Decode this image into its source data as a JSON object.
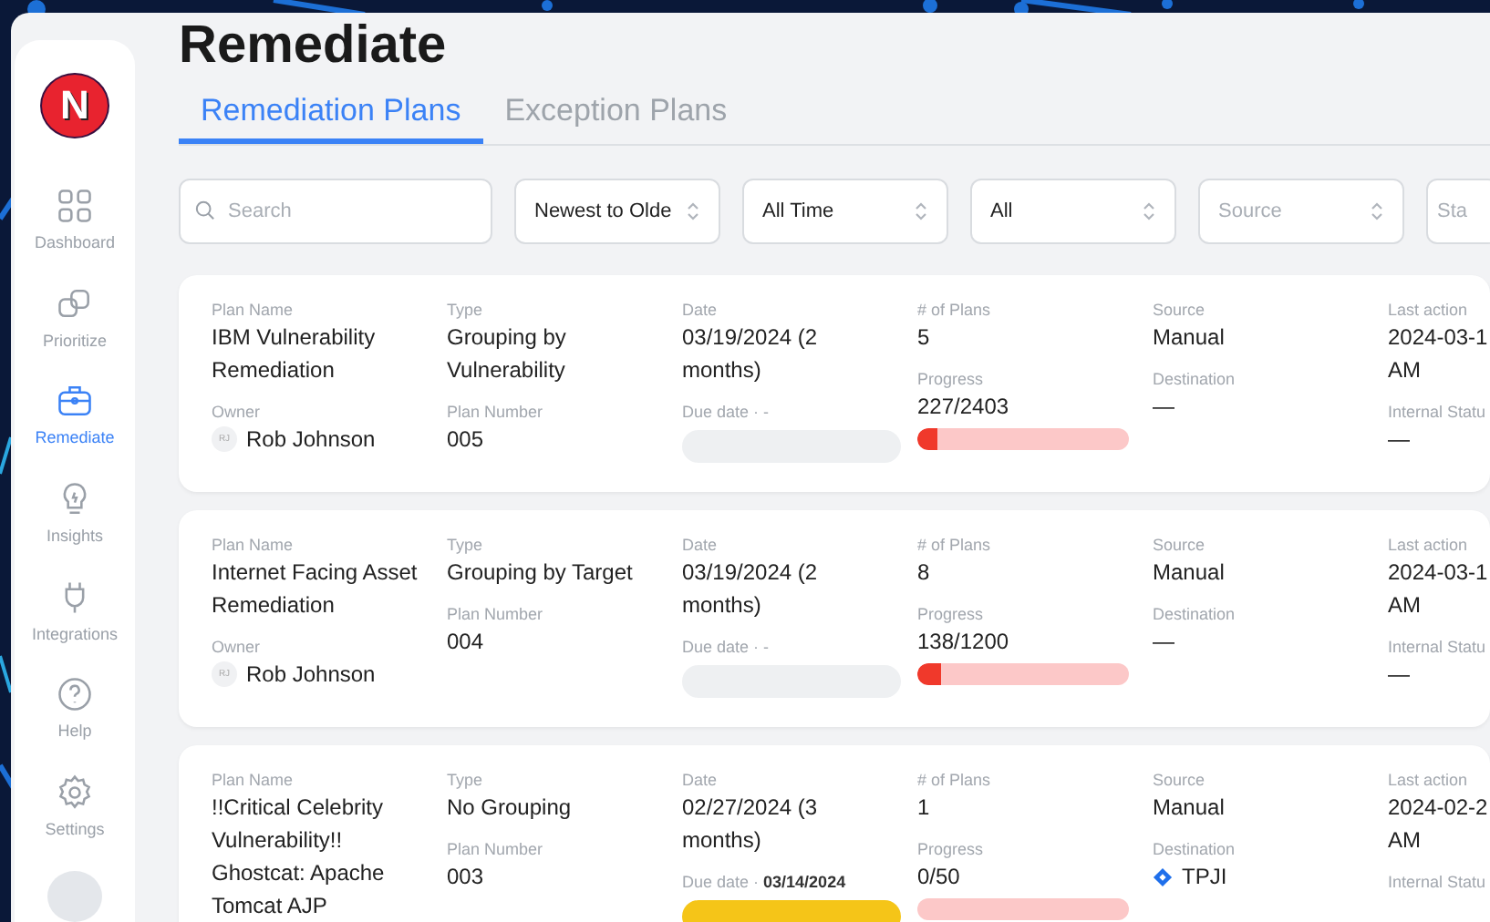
{
  "sidebar": {
    "logo": "N",
    "items": [
      {
        "kind": "dashboard",
        "label": "Dashboard",
        "selected": false
      },
      {
        "kind": "prioritize",
        "label": "Prioritize",
        "selected": false
      },
      {
        "kind": "remediate",
        "label": "Remediate",
        "selected": true
      },
      {
        "kind": "insights",
        "label": "Insights",
        "selected": false
      },
      {
        "kind": "integrations",
        "label": "Integrations",
        "selected": false
      },
      {
        "kind": "help",
        "label": "Help",
        "selected": false
      },
      {
        "kind": "settings",
        "label": "Settings",
        "selected": false
      }
    ]
  },
  "page_title": "Remediate",
  "tabs": [
    {
      "label": "Remediation Plans",
      "selected": true
    },
    {
      "label": "Exception Plans",
      "selected": false
    }
  ],
  "filters": [
    {
      "kind": "search",
      "placeholder": "Search"
    },
    {
      "kind": "select",
      "value": "Newest to Olde"
    },
    {
      "kind": "select",
      "value": "All Time"
    },
    {
      "kind": "select",
      "value": "All"
    },
    {
      "kind": "select",
      "placeholder": "Source"
    },
    {
      "kind": "select",
      "placeholder": "Sta"
    }
  ],
  "plans": [
    {
      "name": {
        "label": "Plan Name",
        "value": "IBM Vulnerability Remediation"
      },
      "owner": {
        "label": "Owner",
        "initials": "RJ",
        "value": "Rob Johnson"
      },
      "type": {
        "label": "Type",
        "value": "Grouping by Vulnerability"
      },
      "plan_number": {
        "label": "Plan Number",
        "value": "005"
      },
      "date": {
        "label": "Date",
        "value": "03/19/2024 (2 months)"
      },
      "due": {
        "text": "Due date · -",
        "kind": "pending"
      },
      "count": {
        "label": "# of Plans",
        "value": "5"
      },
      "progress": {
        "label": "Progress",
        "value": "227/2403",
        "level": 0.094
      },
      "source": {
        "label": "Source",
        "value": "Manual"
      },
      "destination": {
        "label": "Destination",
        "value": "—",
        "linked": false
      },
      "last_action": {
        "label": "Last action",
        "lines": [
          "2024-03-1",
          "AM"
        ]
      },
      "internal_status": {
        "label": "Internal Statu",
        "value": "—"
      }
    },
    {
      "name": {
        "label": "Plan Name",
        "value": "Internet Facing Asset Remediation"
      },
      "owner": {
        "label": "Owner",
        "initials": "RJ",
        "value": "Rob Johnson"
      },
      "type": {
        "label": "Type",
        "value": "Grouping by Target"
      },
      "plan_number": {
        "label": "Plan Number",
        "value": "004"
      },
      "date": {
        "label": "Date",
        "value": "03/19/2024 (2 months)"
      },
      "due": {
        "text": "Due date · -",
        "kind": "pending"
      },
      "count": {
        "label": "# of Plans",
        "value": "8"
      },
      "progress": {
        "label": "Progress",
        "value": "138/1200",
        "level": 0.115
      },
      "source": {
        "label": "Source",
        "value": "Manual"
      },
      "destination": {
        "label": "Destination",
        "value": "—",
        "linked": false
      },
      "last_action": {
        "label": "Last action",
        "lines": [
          "2024-03-1",
          "AM"
        ]
      },
      "internal_status": {
        "label": "Internal Statu",
        "value": "—"
      }
    },
    {
      "name": {
        "label": "Plan Name",
        "value": "!!Critical Celebrity Vulnerability!! Ghostcat: Apache Tomcat AJP"
      },
      "type": {
        "label": "Type",
        "value": "No Grouping"
      },
      "plan_number": {
        "label": "Plan Number",
        "value": "003"
      },
      "date": {
        "label": "Date",
        "value": "02/27/2024 (3 months)"
      },
      "due": {
        "text": "Due date · **03/14/2024**",
        "kind": "overdue"
      },
      "count": {
        "label": "# of Plans",
        "value": "1"
      },
      "progress": {
        "label": "Progress",
        "value": "0/50",
        "level": 0
      },
      "source": {
        "label": "Source",
        "value": "Manual"
      },
      "destination": {
        "label": "Destination",
        "value": "TPJI",
        "linked": true
      },
      "last_action": {
        "label": "Last action",
        "lines": [
          "2024-02-2",
          "AM"
        ]
      },
      "internal_status": {
        "label": "Internal Statu"
      }
    }
  ]
}
